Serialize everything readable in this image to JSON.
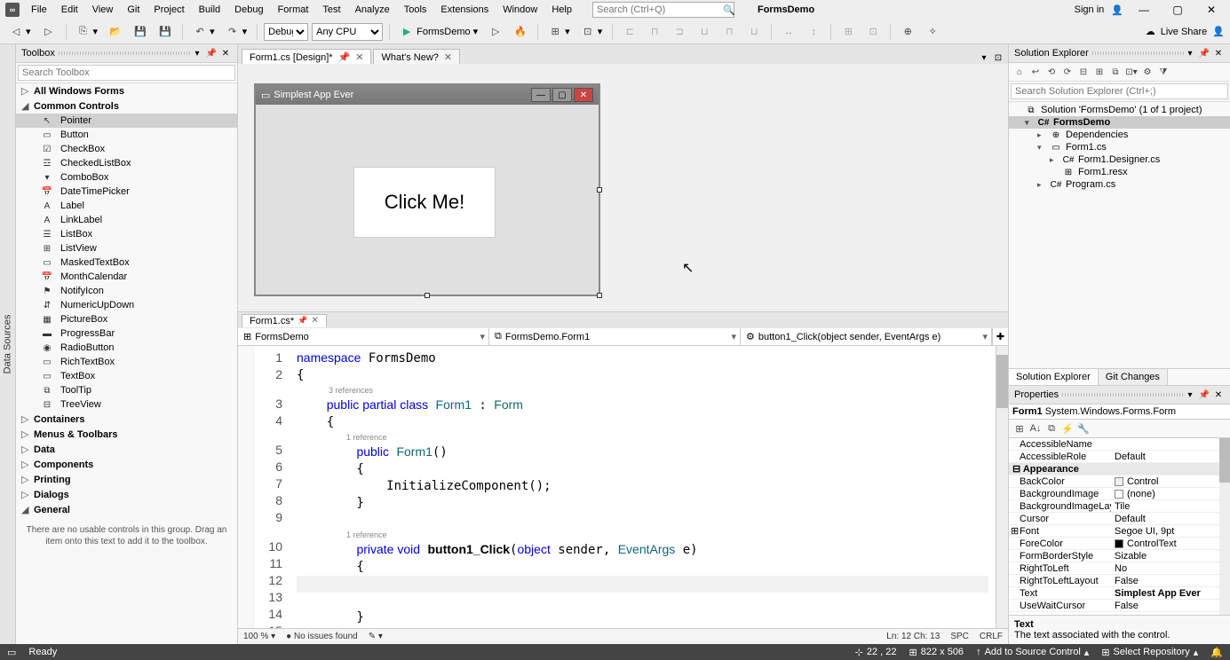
{
  "menubar": [
    "File",
    "Edit",
    "View",
    "Git",
    "Project",
    "Build",
    "Debug",
    "Format",
    "Test",
    "Analyze",
    "Tools",
    "Extensions",
    "Window",
    "Help"
  ],
  "title_search_placeholder": "Search (Ctrl+Q)",
  "project_name": "FormsDemo",
  "signin": "Sign in",
  "liveshare": "Live Share",
  "toolbar": {
    "config": "Debug",
    "platform": "Any CPU",
    "start_label": "FormsDemo"
  },
  "toolbox": {
    "title": "Toolbox",
    "search_placeholder": "Search Toolbox",
    "categories": [
      {
        "label": "All Windows Forms",
        "expanded": false
      },
      {
        "label": "Common Controls",
        "expanded": true,
        "items": [
          {
            "label": "Pointer",
            "selected": true,
            "icon": "↖"
          },
          {
            "label": "Button",
            "icon": "▭"
          },
          {
            "label": "CheckBox",
            "icon": "☑"
          },
          {
            "label": "CheckedListBox",
            "icon": "☲"
          },
          {
            "label": "ComboBox",
            "icon": "▾"
          },
          {
            "label": "DateTimePicker",
            "icon": "📅"
          },
          {
            "label": "Label",
            "icon": "A"
          },
          {
            "label": "LinkLabel",
            "icon": "A"
          },
          {
            "label": "ListBox",
            "icon": "☰"
          },
          {
            "label": "ListView",
            "icon": "⊞"
          },
          {
            "label": "MaskedTextBox",
            "icon": "▭"
          },
          {
            "label": "MonthCalendar",
            "icon": "📅"
          },
          {
            "label": "NotifyIcon",
            "icon": "⚑"
          },
          {
            "label": "NumericUpDown",
            "icon": "⇵"
          },
          {
            "label": "PictureBox",
            "icon": "▦"
          },
          {
            "label": "ProgressBar",
            "icon": "▬"
          },
          {
            "label": "RadioButton",
            "icon": "◉"
          },
          {
            "label": "RichTextBox",
            "icon": "▭"
          },
          {
            "label": "TextBox",
            "icon": "▭"
          },
          {
            "label": "ToolTip",
            "icon": "⧉"
          },
          {
            "label": "TreeView",
            "icon": "⊟"
          }
        ]
      },
      {
        "label": "Containers",
        "expanded": false
      },
      {
        "label": "Menus & Toolbars",
        "expanded": false
      },
      {
        "label": "Data",
        "expanded": false
      },
      {
        "label": "Components",
        "expanded": false
      },
      {
        "label": "Printing",
        "expanded": false
      },
      {
        "label": "Dialogs",
        "expanded": false
      },
      {
        "label": "General",
        "expanded": true
      }
    ],
    "hint": "There are no usable controls in this group. Drag an item onto this text to add it to the toolbox."
  },
  "doctabs": [
    {
      "label": "Form1.cs [Design]*",
      "active": true,
      "pinned": true
    },
    {
      "label": "What's New?",
      "active": false
    }
  ],
  "design_form": {
    "title": "Simplest App Ever",
    "button_text": "Click Me!"
  },
  "codetab": {
    "label": "Form1.cs*"
  },
  "codenav": {
    "project": "FormsDemo",
    "class": "FormsDemo.Form1",
    "member": "button1_Click(object sender, EventArgs e)"
  },
  "code": {
    "ref1": "3 references",
    "ref2": "1 reference",
    "ref3": "1 reference",
    "line_count": 15,
    "zoom": "100 %",
    "issues": "No issues found",
    "pos": "Ln: 12    Ch: 13",
    "indent": "SPC",
    "eol": "CRLF"
  },
  "solution_explorer": {
    "title": "Solution Explorer",
    "search_placeholder": "Search Solution Explorer (Ctrl+;)",
    "tree": [
      {
        "label": "Solution 'FormsDemo' (1 of 1 project)",
        "depth": 0,
        "icon": "⧉",
        "arrow": ""
      },
      {
        "label": "FormsDemo",
        "depth": 1,
        "icon": "C#",
        "bold": true,
        "selected": true,
        "arrow": "▾"
      },
      {
        "label": "Dependencies",
        "depth": 2,
        "icon": "⊕",
        "arrow": "▸"
      },
      {
        "label": "Form1.cs",
        "depth": 2,
        "icon": "▭",
        "arrow": "▾"
      },
      {
        "label": "Form1.Designer.cs",
        "depth": 3,
        "icon": "C#",
        "arrow": "▸"
      },
      {
        "label": "Form1.resx",
        "depth": 3,
        "icon": "⊞",
        "arrow": ""
      },
      {
        "label": "Program.cs",
        "depth": 2,
        "icon": "C#",
        "arrow": "▸"
      }
    ],
    "tabs": [
      "Solution Explorer",
      "Git Changes"
    ]
  },
  "properties": {
    "title": "Properties",
    "object": "Form1",
    "object_type": "System.Windows.Forms.Form",
    "rows": [
      {
        "name": "AccessibleName",
        "val": ""
      },
      {
        "name": "AccessibleRole",
        "val": "Default"
      },
      {
        "cat": "Appearance"
      },
      {
        "name": "BackColor",
        "val": "Control",
        "swatch": "#eee"
      },
      {
        "name": "BackgroundImage",
        "val": "(none)",
        "swatch": "#fff"
      },
      {
        "name": "BackgroundImageLayout",
        "val": "Tile"
      },
      {
        "name": "Cursor",
        "val": "Default"
      },
      {
        "name": "Font",
        "val": "Segoe UI, 9pt",
        "expand": true
      },
      {
        "name": "ForeColor",
        "val": "ControlText",
        "swatch": "#000"
      },
      {
        "name": "FormBorderStyle",
        "val": "Sizable"
      },
      {
        "name": "RightToLeft",
        "val": "No"
      },
      {
        "name": "RightToLeftLayout",
        "val": "False"
      },
      {
        "name": "Text",
        "val": "Simplest App Ever",
        "bold": true
      },
      {
        "name": "UseWaitCursor",
        "val": "False"
      }
    ],
    "help_name": "Text",
    "help_desc": "The text associated with the control."
  },
  "statusbar": {
    "ready": "Ready",
    "pos": "22 , 22",
    "size": "822 x 506",
    "source": "Add to Source Control",
    "repo": "Select Repository"
  },
  "data_sources_label": "Data Sources"
}
